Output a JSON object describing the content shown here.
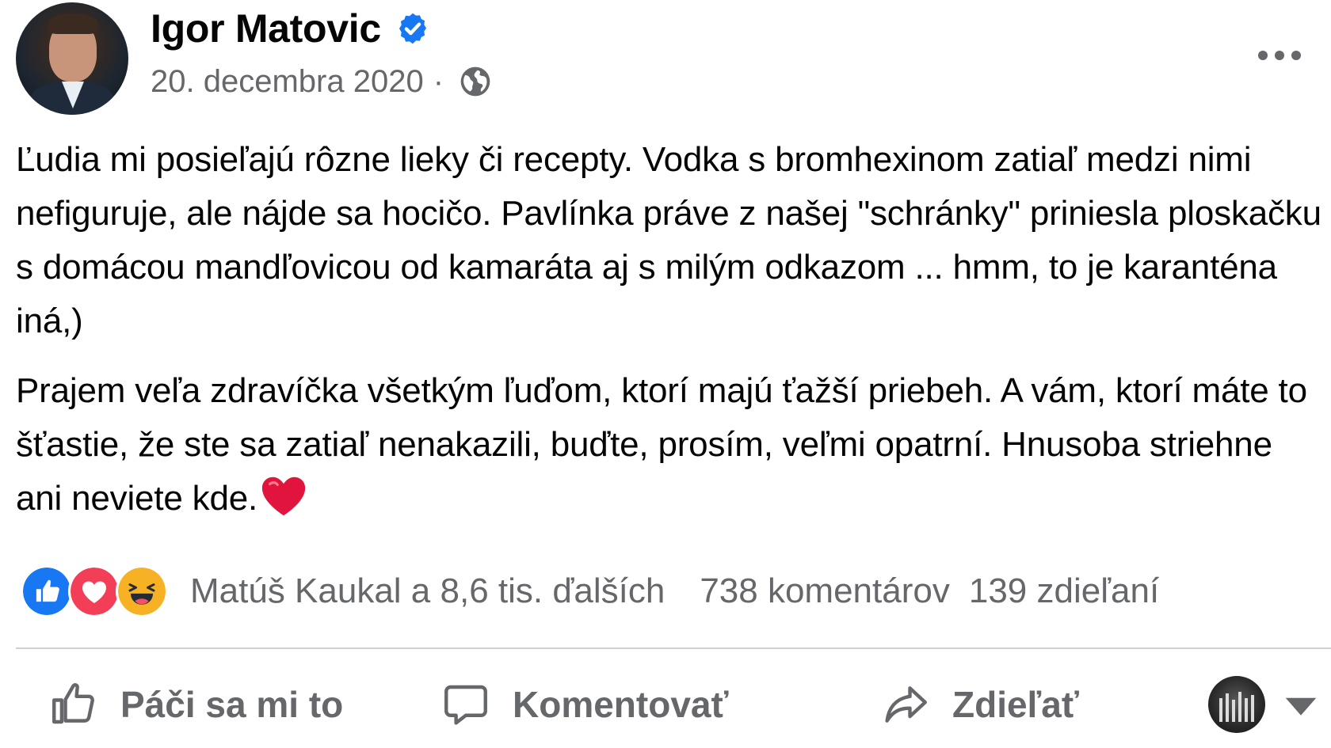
{
  "post": {
    "author": "Igor Matovic",
    "date": "20. decembra 2020",
    "separator": "·",
    "paragraphs": [
      "Ľudia mi posieľajú rôzne lieky či recepty. Vodka s bromhexinom zatiaľ medzi nimi nefiguruje, ale nájde sa hocičo. Pavlínka práve z našej \"schránky\" priniesla ploskačku s domácou mandľovicou od kamaráta aj s milým odkazom ... hmm, to je karanténa iná,)",
      "Prajem veľa zdravíčka všetkým ľuďom, ktorí majú ťažší priebeh. A vám, ktorí máte to šťastie, že ste sa zatiaľ nenakazili, buďte, prosím, veľmi opatrní. Hnusoba striehne ani neviete kde."
    ]
  },
  "reactions": {
    "summary": "Matúš Kaukal a 8,6 tis. ďalších",
    "comments": "738 komentárov",
    "shares": "139 zdieľaní",
    "icons": [
      "like-icon",
      "love-icon",
      "haha-icon"
    ]
  },
  "actions": {
    "like": "Páči sa mi to",
    "comment": "Komentovať",
    "share": "Zdieľať"
  },
  "colors": {
    "text": "#050505",
    "secondary": "#65676b",
    "verified": "#1877f2",
    "like": "#1877f2",
    "love": "#f33e58",
    "haha": "#f7b125",
    "divider": "#ced0d4"
  }
}
